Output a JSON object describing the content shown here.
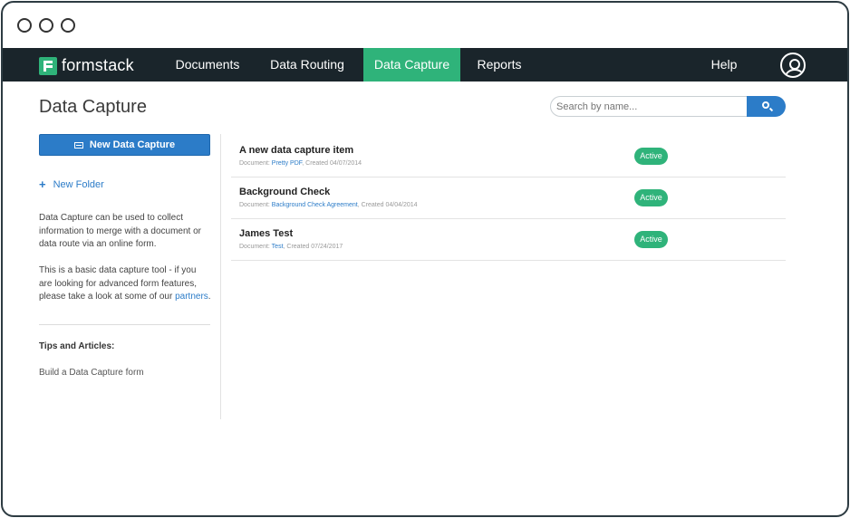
{
  "brand": {
    "name": "formstack",
    "color": "#2fb37a"
  },
  "nav": {
    "items": [
      {
        "label": "Documents"
      },
      {
        "label": "Data Routing"
      },
      {
        "label": "Data Capture"
      },
      {
        "label": "Reports"
      }
    ],
    "help": "Help",
    "active_color": "#2fb37a",
    "bar_color": "#1a252b"
  },
  "page": {
    "title": "Data Capture"
  },
  "search": {
    "placeholder": "Search by name...",
    "button_icon": "search-icon"
  },
  "sidebar": {
    "new_button": "New Data Capture",
    "new_folder": "New Folder",
    "desc1": "Data Capture can be used to collect information to merge with a document or data route via an online form.",
    "desc2_pre": "This is a basic data capture tool - if you are looking for advanced form features, please take a look at some of our ",
    "desc2_link": "partners",
    "desc2_post": ".",
    "tips_title": "Tips and Articles:",
    "tips_link": "Build a Data Capture form"
  },
  "items": [
    {
      "title": "A new data capture item",
      "doc_prefix": "Document: ",
      "doc": "Pretty PDF",
      "created": ", Created 04/07/2014",
      "status": "Active"
    },
    {
      "title": "Background Check",
      "doc_prefix": "Document: ",
      "doc": "Background Check Agreement",
      "created": ", Created 04/04/2014",
      "status": "Active"
    },
    {
      "title": "James Test",
      "doc_prefix": "Document: ",
      "doc": "Test",
      "created": ", Created 07/24/2017",
      "status": "Active"
    }
  ]
}
